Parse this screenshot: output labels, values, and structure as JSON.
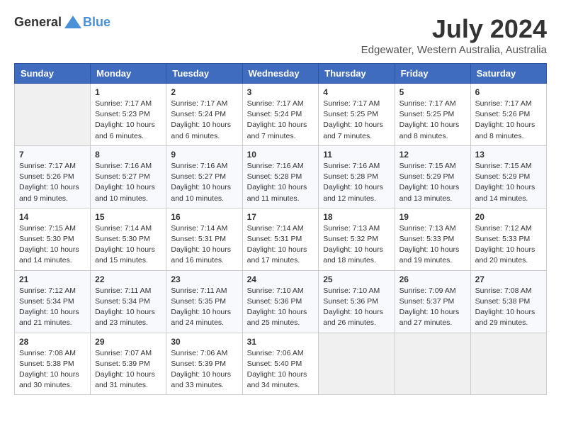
{
  "logo": {
    "general": "General",
    "blue": "Blue"
  },
  "title": {
    "month": "July 2024",
    "location": "Edgewater, Western Australia, Australia"
  },
  "headers": [
    "Sunday",
    "Monday",
    "Tuesday",
    "Wednesday",
    "Thursday",
    "Friday",
    "Saturday"
  ],
  "weeks": [
    [
      {
        "day": "",
        "info": ""
      },
      {
        "day": "1",
        "info": "Sunrise: 7:17 AM\nSunset: 5:23 PM\nDaylight: 10 hours\nand 6 minutes."
      },
      {
        "day": "2",
        "info": "Sunrise: 7:17 AM\nSunset: 5:24 PM\nDaylight: 10 hours\nand 6 minutes."
      },
      {
        "day": "3",
        "info": "Sunrise: 7:17 AM\nSunset: 5:24 PM\nDaylight: 10 hours\nand 7 minutes."
      },
      {
        "day": "4",
        "info": "Sunrise: 7:17 AM\nSunset: 5:25 PM\nDaylight: 10 hours\nand 7 minutes."
      },
      {
        "day": "5",
        "info": "Sunrise: 7:17 AM\nSunset: 5:25 PM\nDaylight: 10 hours\nand 8 minutes."
      },
      {
        "day": "6",
        "info": "Sunrise: 7:17 AM\nSunset: 5:26 PM\nDaylight: 10 hours\nand 8 minutes."
      }
    ],
    [
      {
        "day": "7",
        "info": "Sunrise: 7:17 AM\nSunset: 5:26 PM\nDaylight: 10 hours\nand 9 minutes."
      },
      {
        "day": "8",
        "info": "Sunrise: 7:16 AM\nSunset: 5:27 PM\nDaylight: 10 hours\nand 10 minutes."
      },
      {
        "day": "9",
        "info": "Sunrise: 7:16 AM\nSunset: 5:27 PM\nDaylight: 10 hours\nand 10 minutes."
      },
      {
        "day": "10",
        "info": "Sunrise: 7:16 AM\nSunset: 5:28 PM\nDaylight: 10 hours\nand 11 minutes."
      },
      {
        "day": "11",
        "info": "Sunrise: 7:16 AM\nSunset: 5:28 PM\nDaylight: 10 hours\nand 12 minutes."
      },
      {
        "day": "12",
        "info": "Sunrise: 7:15 AM\nSunset: 5:29 PM\nDaylight: 10 hours\nand 13 minutes."
      },
      {
        "day": "13",
        "info": "Sunrise: 7:15 AM\nSunset: 5:29 PM\nDaylight: 10 hours\nand 14 minutes."
      }
    ],
    [
      {
        "day": "14",
        "info": "Sunrise: 7:15 AM\nSunset: 5:30 PM\nDaylight: 10 hours\nand 14 minutes."
      },
      {
        "day": "15",
        "info": "Sunrise: 7:14 AM\nSunset: 5:30 PM\nDaylight: 10 hours\nand 15 minutes."
      },
      {
        "day": "16",
        "info": "Sunrise: 7:14 AM\nSunset: 5:31 PM\nDaylight: 10 hours\nand 16 minutes."
      },
      {
        "day": "17",
        "info": "Sunrise: 7:14 AM\nSunset: 5:31 PM\nDaylight: 10 hours\nand 17 minutes."
      },
      {
        "day": "18",
        "info": "Sunrise: 7:13 AM\nSunset: 5:32 PM\nDaylight: 10 hours\nand 18 minutes."
      },
      {
        "day": "19",
        "info": "Sunrise: 7:13 AM\nSunset: 5:33 PM\nDaylight: 10 hours\nand 19 minutes."
      },
      {
        "day": "20",
        "info": "Sunrise: 7:12 AM\nSunset: 5:33 PM\nDaylight: 10 hours\nand 20 minutes."
      }
    ],
    [
      {
        "day": "21",
        "info": "Sunrise: 7:12 AM\nSunset: 5:34 PM\nDaylight: 10 hours\nand 21 minutes."
      },
      {
        "day": "22",
        "info": "Sunrise: 7:11 AM\nSunset: 5:34 PM\nDaylight: 10 hours\nand 23 minutes."
      },
      {
        "day": "23",
        "info": "Sunrise: 7:11 AM\nSunset: 5:35 PM\nDaylight: 10 hours\nand 24 minutes."
      },
      {
        "day": "24",
        "info": "Sunrise: 7:10 AM\nSunset: 5:36 PM\nDaylight: 10 hours\nand 25 minutes."
      },
      {
        "day": "25",
        "info": "Sunrise: 7:10 AM\nSunset: 5:36 PM\nDaylight: 10 hours\nand 26 minutes."
      },
      {
        "day": "26",
        "info": "Sunrise: 7:09 AM\nSunset: 5:37 PM\nDaylight: 10 hours\nand 27 minutes."
      },
      {
        "day": "27",
        "info": "Sunrise: 7:08 AM\nSunset: 5:38 PM\nDaylight: 10 hours\nand 29 minutes."
      }
    ],
    [
      {
        "day": "28",
        "info": "Sunrise: 7:08 AM\nSunset: 5:38 PM\nDaylight: 10 hours\nand 30 minutes."
      },
      {
        "day": "29",
        "info": "Sunrise: 7:07 AM\nSunset: 5:39 PM\nDaylight: 10 hours\nand 31 minutes."
      },
      {
        "day": "30",
        "info": "Sunrise: 7:06 AM\nSunset: 5:39 PM\nDaylight: 10 hours\nand 33 minutes."
      },
      {
        "day": "31",
        "info": "Sunrise: 7:06 AM\nSunset: 5:40 PM\nDaylight: 10 hours\nand 34 minutes."
      },
      {
        "day": "",
        "info": ""
      },
      {
        "day": "",
        "info": ""
      },
      {
        "day": "",
        "info": ""
      }
    ]
  ]
}
